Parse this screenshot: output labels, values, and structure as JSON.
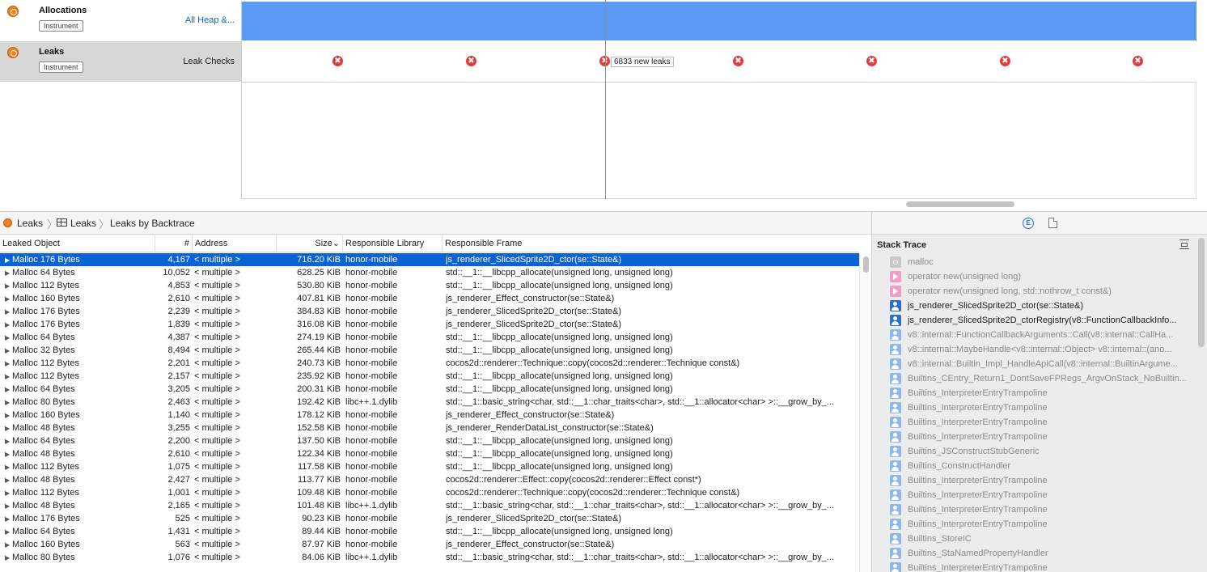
{
  "instruments": {
    "allocations": {
      "name": "Allocations",
      "tag": "Instrument",
      "detail": "All Heap &..."
    },
    "leaks": {
      "name": "Leaks",
      "tag": "Instrument",
      "detail": "Leak Checks"
    }
  },
  "timeline": {
    "leak_marker_symbol": "✖",
    "leak_tooltip": "6833 new leaks",
    "colors": {
      "allocation_band": "#5b9af4",
      "leak_marker": "#e43a3a",
      "selection": "#0a63d6"
    }
  },
  "breadcrumb": {
    "items": [
      "Leaks",
      "Leaks",
      "Leaks by Backtrace"
    ]
  },
  "table": {
    "columns": {
      "object": "Leaked Object",
      "count": "#",
      "address": "Address",
      "size": "Size",
      "library": "Responsible Library",
      "frame": "Responsible Frame"
    },
    "sort_indicator": "⌄",
    "rows": [
      {
        "object": "Malloc 176 Bytes",
        "count": "4,167",
        "address": "< multiple >",
        "size": "716.20 KiB",
        "library": "honor-mobile",
        "frame": "js_renderer_SlicedSprite2D_ctor(se::State&)"
      },
      {
        "object": "Malloc 64 Bytes",
        "count": "10,052",
        "address": "< multiple >",
        "size": "628.25 KiB",
        "library": "honor-mobile",
        "frame": "std::__1::__libcpp_allocate(unsigned long, unsigned long)"
      },
      {
        "object": "Malloc 112 Bytes",
        "count": "4,853",
        "address": "< multiple >",
        "size": "530.80 KiB",
        "library": "honor-mobile",
        "frame": "std::__1::__libcpp_allocate(unsigned long, unsigned long)"
      },
      {
        "object": "Malloc 160 Bytes",
        "count": "2,610",
        "address": "< multiple >",
        "size": "407.81 KiB",
        "library": "honor-mobile",
        "frame": "js_renderer_Effect_constructor(se::State&)"
      },
      {
        "object": "Malloc 176 Bytes",
        "count": "2,239",
        "address": "< multiple >",
        "size": "384.83 KiB",
        "library": "honor-mobile",
        "frame": "js_renderer_SlicedSprite2D_ctor(se::State&)"
      },
      {
        "object": "Malloc 176 Bytes",
        "count": "1,839",
        "address": "< multiple >",
        "size": "316.08 KiB",
        "library": "honor-mobile",
        "frame": "js_renderer_SlicedSprite2D_ctor(se::State&)"
      },
      {
        "object": "Malloc 64 Bytes",
        "count": "4,387",
        "address": "< multiple >",
        "size": "274.19 KiB",
        "library": "honor-mobile",
        "frame": "std::__1::__libcpp_allocate(unsigned long, unsigned long)"
      },
      {
        "object": "Malloc 32 Bytes",
        "count": "8,494",
        "address": "< multiple >",
        "size": "265.44 KiB",
        "library": "honor-mobile",
        "frame": "std::__1::__libcpp_allocate(unsigned long, unsigned long)"
      },
      {
        "object": "Malloc 112 Bytes",
        "count": "2,201",
        "address": "< multiple >",
        "size": "240.73 KiB",
        "library": "honor-mobile",
        "frame": "cocos2d::renderer::Technique::copy(cocos2d::renderer::Technique const&)"
      },
      {
        "object": "Malloc 112 Bytes",
        "count": "2,157",
        "address": "< multiple >",
        "size": "235.92 KiB",
        "library": "honor-mobile",
        "frame": "std::__1::__libcpp_allocate(unsigned long, unsigned long)"
      },
      {
        "object": "Malloc 64 Bytes",
        "count": "3,205",
        "address": "< multiple >",
        "size": "200.31 KiB",
        "library": "honor-mobile",
        "frame": "std::__1::__libcpp_allocate(unsigned long, unsigned long)"
      },
      {
        "object": "Malloc 80 Bytes",
        "count": "2,463",
        "address": "< multiple >",
        "size": "192.42 KiB",
        "library": "libc++.1.dylib",
        "frame": "std::__1::basic_string<char, std::__1::char_traits<char>, std::__1::allocator<char> >::__grow_by_..."
      },
      {
        "object": "Malloc 160 Bytes",
        "count": "1,140",
        "address": "< multiple >",
        "size": "178.12 KiB",
        "library": "honor-mobile",
        "frame": "js_renderer_Effect_constructor(se::State&)"
      },
      {
        "object": "Malloc 48 Bytes",
        "count": "3,255",
        "address": "< multiple >",
        "size": "152.58 KiB",
        "library": "honor-mobile",
        "frame": "js_renderer_RenderDataList_constructor(se::State&)"
      },
      {
        "object": "Malloc 64 Bytes",
        "count": "2,200",
        "address": "< multiple >",
        "size": "137.50 KiB",
        "library": "honor-mobile",
        "frame": "std::__1::__libcpp_allocate(unsigned long, unsigned long)"
      },
      {
        "object": "Malloc 48 Bytes",
        "count": "2,610",
        "address": "< multiple >",
        "size": "122.34 KiB",
        "library": "honor-mobile",
        "frame": "std::__1::__libcpp_allocate(unsigned long, unsigned long)"
      },
      {
        "object": "Malloc 112 Bytes",
        "count": "1,075",
        "address": "< multiple >",
        "size": "117.58 KiB",
        "library": "honor-mobile",
        "frame": "std::__1::__libcpp_allocate(unsigned long, unsigned long)"
      },
      {
        "object": "Malloc 48 Bytes",
        "count": "2,427",
        "address": "< multiple >",
        "size": "113.77 KiB",
        "library": "honor-mobile",
        "frame": "cocos2d::renderer::Effect::copy(cocos2d::renderer::Effect const*)"
      },
      {
        "object": "Malloc 112 Bytes",
        "count": "1,001",
        "address": "< multiple >",
        "size": "109.48 KiB",
        "library": "honor-mobile",
        "frame": "cocos2d::renderer::Technique::copy(cocos2d::renderer::Technique const&)"
      },
      {
        "object": "Malloc 48 Bytes",
        "count": "2,165",
        "address": "< multiple >",
        "size": "101.48 KiB",
        "library": "libc++.1.dylib",
        "frame": "std::__1::basic_string<char, std::__1::char_traits<char>, std::__1::allocator<char> >::__grow_by_..."
      },
      {
        "object": "Malloc 176 Bytes",
        "count": "525",
        "address": "< multiple >",
        "size": "90.23 KiB",
        "library": "honor-mobile",
        "frame": "js_renderer_SlicedSprite2D_ctor(se::State&)"
      },
      {
        "object": "Malloc 64 Bytes",
        "count": "1,431",
        "address": "< multiple >",
        "size": "89.44 KiB",
        "library": "honor-mobile",
        "frame": "std::__1::__libcpp_allocate(unsigned long, unsigned long)"
      },
      {
        "object": "Malloc 160 Bytes",
        "count": "563",
        "address": "< multiple >",
        "size": "87.97 KiB",
        "library": "honor-mobile",
        "frame": "js_renderer_Effect_constructor(se::State&)"
      },
      {
        "object": "Malloc 80 Bytes",
        "count": "1,076",
        "address": "< multiple >",
        "size": "84.06 KiB",
        "library": "libc++.1.dylib",
        "frame": "std::__1::basic_string<char, std::__1::char_traits<char>, std::__1::allocator<char> >::__grow_by_..."
      }
    ]
  },
  "stack_trace": {
    "title": "Stack Trace",
    "frames": [
      {
        "icon": "sys",
        "name": "malloc"
      },
      {
        "icon": "cpp",
        "name": "operator new(unsigned long)"
      },
      {
        "icon": "cpp",
        "name": "operator new(unsigned long, std::nothrow_t const&)"
      },
      {
        "icon": "usr-dark",
        "name": "js_renderer_SlicedSprite2D_ctor(se::State&)"
      },
      {
        "icon": "usr-dark",
        "name": "js_renderer_SlicedSprite2D_ctorRegistry(v8::FunctionCallbackInfo..."
      },
      {
        "icon": "usr",
        "name": "v8::internal::FunctionCallbackArguments::Call(v8::internal::CallHa..."
      },
      {
        "icon": "usr",
        "name": "v8::internal::MaybeHandle<v8::internal::Object> v8::internal::(ano..."
      },
      {
        "icon": "usr",
        "name": "v8::internal::Builtin_Impl_HandleApiCall(v8::internal::BuiltinArgume..."
      },
      {
        "icon": "usr",
        "name": "Builtins_CEntry_Return1_DontSaveFPRegs_ArgvOnStack_NoBuiltin..."
      },
      {
        "icon": "usr",
        "name": "Builtins_InterpreterEntryTrampoline"
      },
      {
        "icon": "usr",
        "name": "Builtins_InterpreterEntryTrampoline"
      },
      {
        "icon": "usr",
        "name": "Builtins_InterpreterEntryTrampoline"
      },
      {
        "icon": "usr",
        "name": "Builtins_InterpreterEntryTrampoline"
      },
      {
        "icon": "usr",
        "name": "Builtins_JSConstructStubGeneric"
      },
      {
        "icon": "usr",
        "name": "Builtins_ConstructHandler"
      },
      {
        "icon": "usr",
        "name": "Builtins_InterpreterEntryTrampoline"
      },
      {
        "icon": "usr",
        "name": "Builtins_InterpreterEntryTrampoline"
      },
      {
        "icon": "usr",
        "name": "Builtins_InterpreterEntryTrampoline"
      },
      {
        "icon": "usr",
        "name": "Builtins_InterpreterEntryTrampoline"
      },
      {
        "icon": "usr",
        "name": "Builtins_StoreIC"
      },
      {
        "icon": "usr",
        "name": "Builtins_StaNamedPropertyHandler"
      },
      {
        "icon": "usr",
        "name": "Builtins_InterpreterEntryTrampoline"
      }
    ]
  }
}
